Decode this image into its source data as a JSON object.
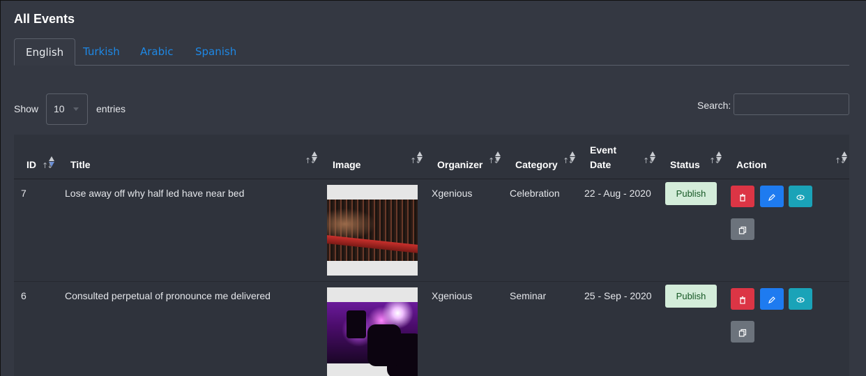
{
  "page": {
    "title": "All Events"
  },
  "tabs": [
    {
      "label": "English",
      "active": true
    },
    {
      "label": "Turkish",
      "active": false
    },
    {
      "label": "Arabic",
      "active": false
    },
    {
      "label": "Spanish",
      "active": false
    }
  ],
  "controls": {
    "show_label": "Show",
    "entries_value": "10",
    "entries_label": "entries",
    "search_label": "Search:",
    "search_value": ""
  },
  "table": {
    "columns": {
      "id": "ID",
      "title": "Title",
      "image": "Image",
      "organizer": "Organizer",
      "category": "Category",
      "event_date_line1": "Event",
      "event_date_line2": "Date",
      "status": "Status",
      "action": "Action"
    },
    "rows": [
      {
        "id": "7",
        "title": "Lose away off why half led have near bed",
        "organizer": "Xgenious",
        "category": "Celebration",
        "event_date": "22 - Aug - 2020",
        "status": "Publish"
      },
      {
        "id": "6",
        "title": "Consulted perpetual of pronounce me delivered",
        "organizer": "Xgenious",
        "category": "Seminar",
        "event_date": "25 - Sep - 2020",
        "status": "Publish"
      }
    ]
  },
  "colors": {
    "background": "#343842",
    "tab_link": "#1e88e5",
    "publish_badge": "#d4edda",
    "delete_button": "#dc3545",
    "edit_button": "#1e7bf0",
    "view_button": "#1aa3b8",
    "copy_button": "#6c737c"
  },
  "icons": {
    "delete": "trash-icon",
    "edit": "pencil-icon",
    "view": "eye-icon",
    "copy": "copy-icon"
  }
}
